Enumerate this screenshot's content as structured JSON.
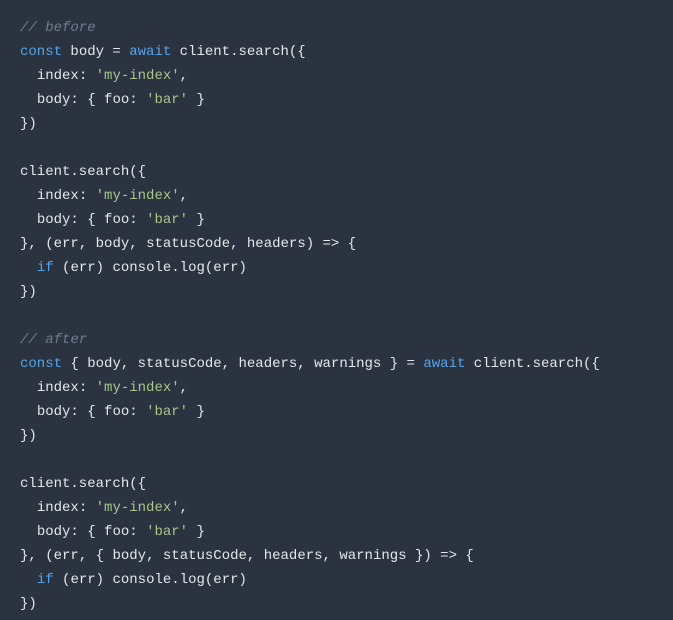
{
  "code": {
    "comment_before": "// before",
    "comment_after": "// after",
    "kw_const": "const",
    "kw_await": "await",
    "kw_if": "if",
    "ident_body": "body",
    "ident_client_search": "client.search",
    "ident_index": "index",
    "ident_body_key": "body",
    "ident_foo": "foo",
    "ident_err": "err",
    "ident_statusCode": "statusCode",
    "ident_headers": "headers",
    "ident_warnings": "warnings",
    "ident_console_log": "console.log",
    "str_my_index": "'my-index'",
    "str_bar": "'bar'",
    "p_eq": " = ",
    "p_open_paren_brace": "({",
    "p_colon_sp": ": ",
    "p_comma": ",",
    "p_open_brace": "{ ",
    "p_close_brace": " }",
    "p_close_brace_paren": "})",
    "p_close_brace_comma": "}, ",
    "p_open_paren": "(",
    "p_close_paren": ")",
    "p_arrow": " => {",
    "p_comma_sp": ", ",
    "p_open_brace_only": "{ ",
    "p_close_brace_only": " }",
    "indent": "  "
  }
}
